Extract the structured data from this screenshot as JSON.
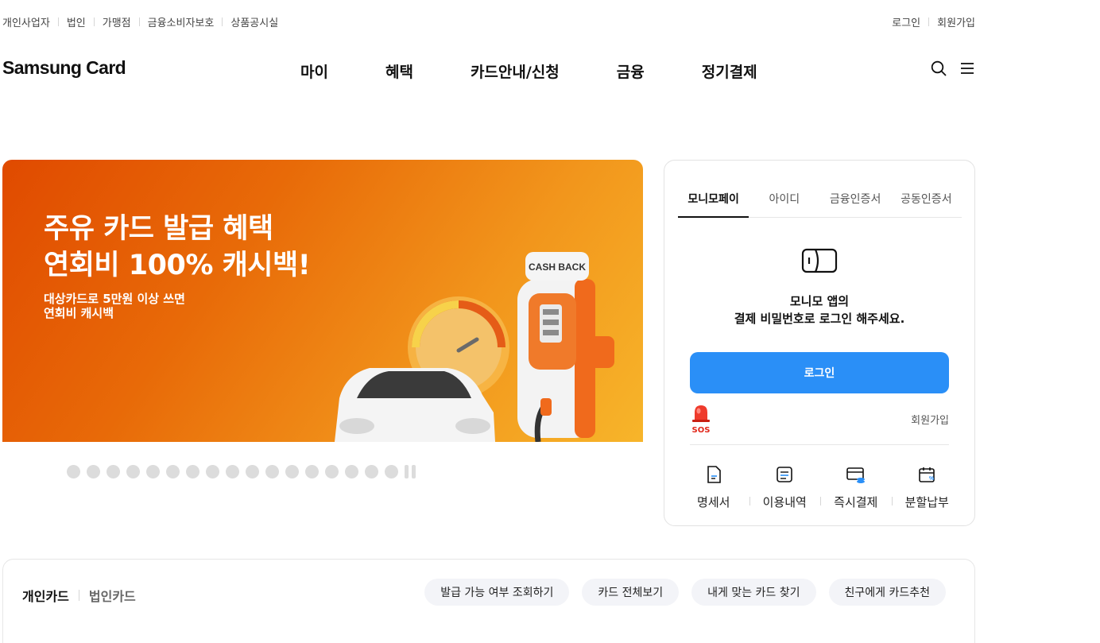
{
  "util_nav": [
    "개인사업자",
    "법인",
    "가맹점",
    "금융소비자보호",
    "상품공시실"
  ],
  "util_right": {
    "login": "로그인",
    "join": "회원가입"
  },
  "logo": "Samsung Card",
  "gnb": [
    "마이",
    "혜택",
    "카드안내/신청",
    "금융",
    "정기결제"
  ],
  "icons": {
    "search": "search-icon",
    "menu": "hamburger-menu-icon"
  },
  "banner": {
    "title_line1": "주유 카드 발급 혜택",
    "title_line2": "연회비 100% 캐시백!",
    "sub_line1": "대상카드로 5만원 이상 쓰면",
    "sub_line2": "연회비 캐시백",
    "sign_text": "CASH BACK",
    "colors": {
      "start": "#e04a00",
      "end": "#f7b52a"
    }
  },
  "carousel": {
    "dot_count": 17
  },
  "login_box": {
    "tabs": [
      "모니모페이",
      "아이디",
      "금융인증서",
      "공동인증서"
    ],
    "active_tab": "모니모페이",
    "msg_line1": "모니모 앱의",
    "msg_line2": "결제 비밀번호로 로그인 해주세요.",
    "login_button": "로그인",
    "sos_label": "SOS",
    "join_label": "회원가입",
    "quick": [
      "명세서",
      "이용내역",
      "즉시결제",
      "분할납부"
    ],
    "accent": "#2a8ff7"
  },
  "card_section": {
    "tab_personal": "개인카드",
    "tab_corporate": "법인카드",
    "pills": [
      "발급 가능 여부 조회하기",
      "카드 전체보기",
      "내게 맞는 카드 찾기",
      "친구에게 카드추천"
    ]
  }
}
